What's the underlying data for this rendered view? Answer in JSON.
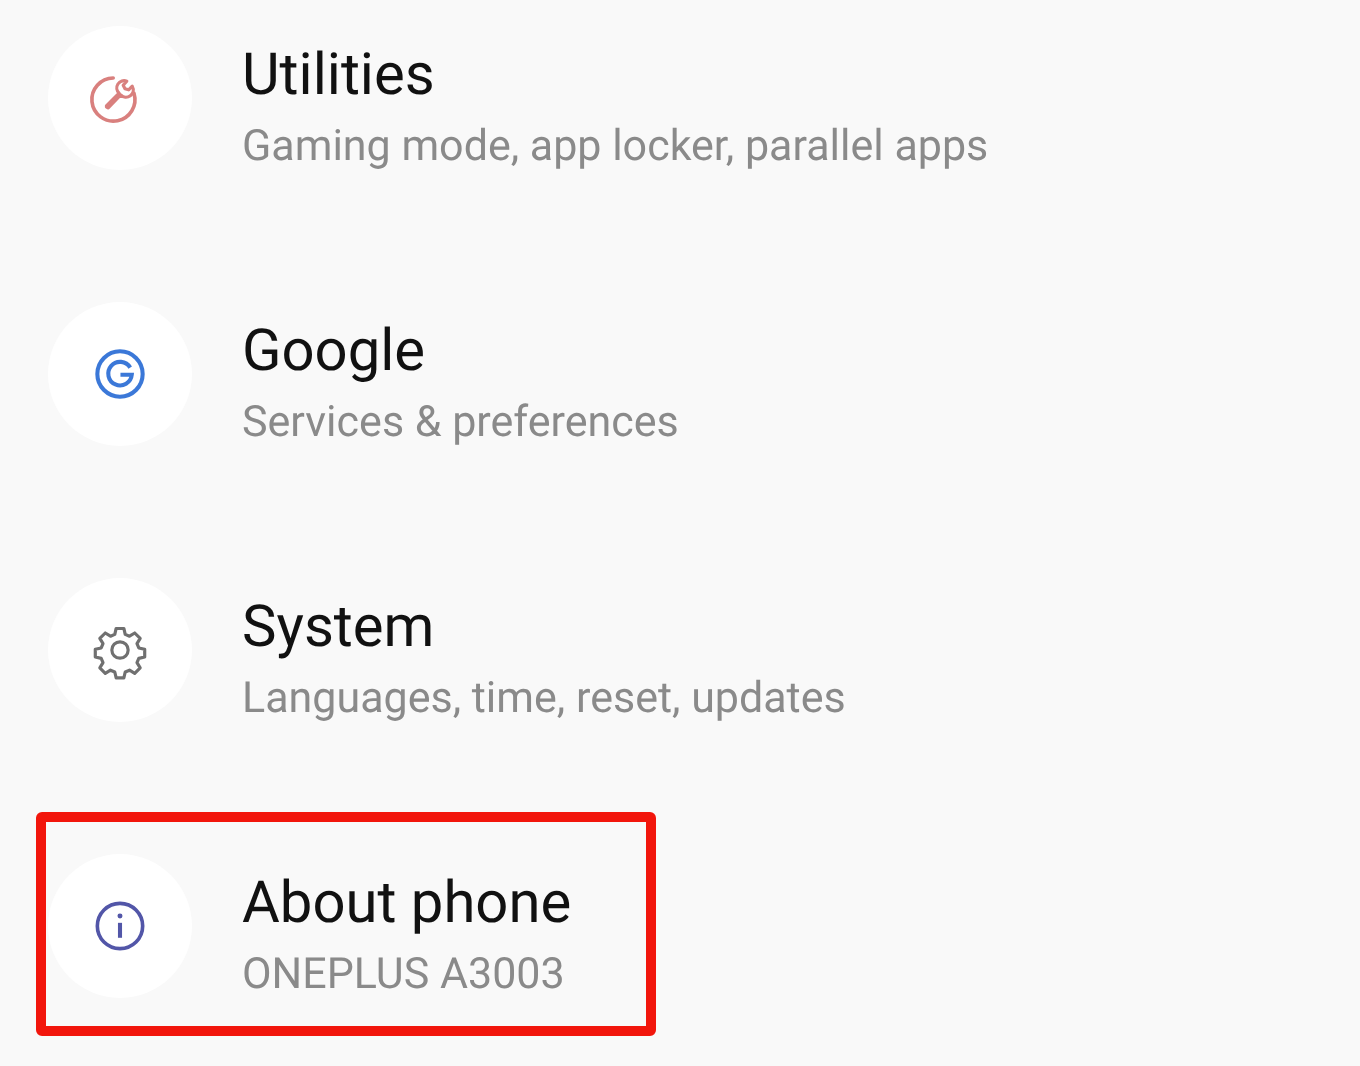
{
  "settings_items": [
    {
      "kind": "utilities",
      "title": "Utilities",
      "subtitle": "Gaming mode, app locker, parallel apps",
      "highlighted": false
    },
    {
      "kind": "google",
      "title": "Google",
      "subtitle": "Services & preferences",
      "highlighted": false
    },
    {
      "kind": "system",
      "title": "System",
      "subtitle": "Languages, time, reset, updates",
      "highlighted": false
    },
    {
      "kind": "about",
      "title": "About phone",
      "subtitle": "ONEPLUS A3003",
      "highlighted": true
    }
  ]
}
